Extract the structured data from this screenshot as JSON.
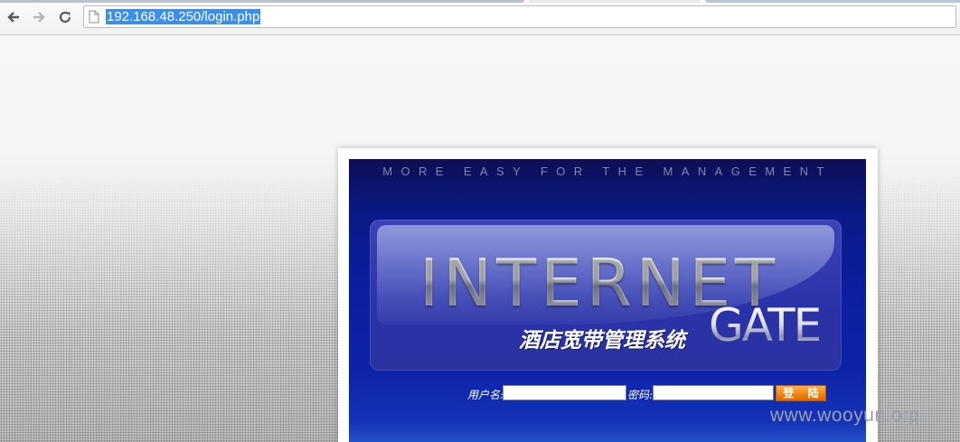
{
  "browser": {
    "url": "192.168.48.250/login.php",
    "icons": [
      "back-arrow-icon",
      "forward-arrow-icon",
      "reload-icon",
      "page-icon"
    ]
  },
  "login_panel": {
    "tagline": "MORE EASY FOR THE MANAGEMENT",
    "brand_title": "INTERNET",
    "brand_subtitle": "GATE",
    "product_name": "酒店宽带管理系统",
    "username_label": "用户名:",
    "username_value": "",
    "password_label": "密码:",
    "password_value": "",
    "login_button": "登 陆"
  },
  "watermark": "www.wooyun.org",
  "colors": {
    "panel_dark": "#0c0f52",
    "panel_blue": "#0c22a8",
    "button_orange": "#f0820f",
    "url_highlight": "#3b8ee9"
  }
}
